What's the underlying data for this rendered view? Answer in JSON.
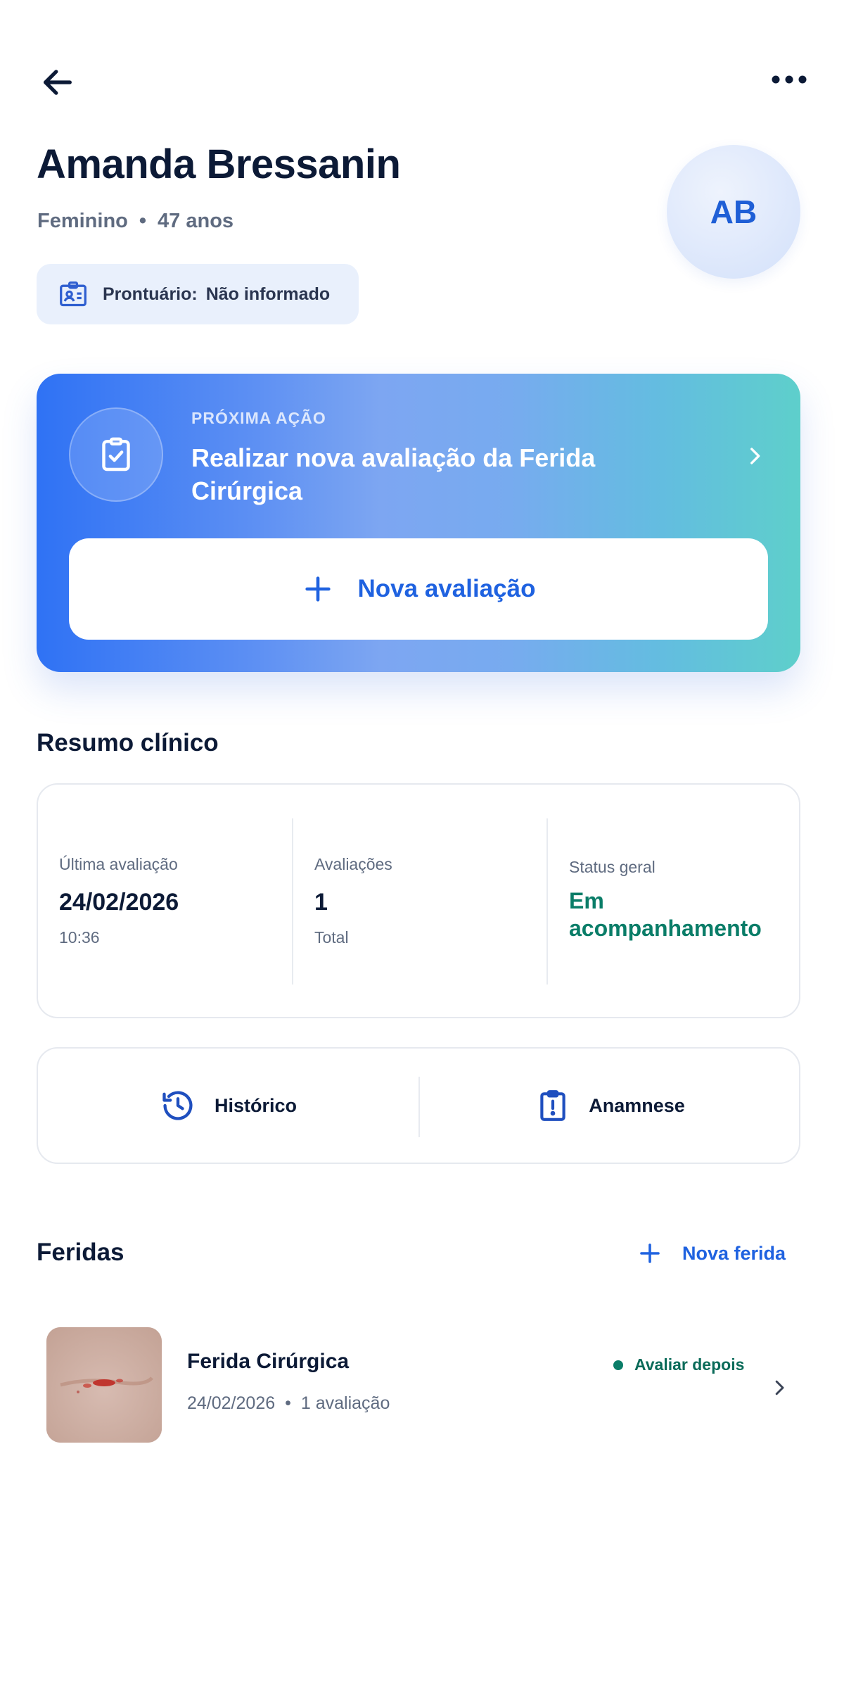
{
  "patient": {
    "name": "Amanda Bressanin",
    "gender": "Feminino",
    "age": "47 anos",
    "initials": "AB",
    "record_label": "Prontuário:",
    "record_value": "Não informado"
  },
  "next_action": {
    "kicker": "PRÓXIMA AÇÃO",
    "title": "Realizar nova avaliação da Ferida Cirúrgica",
    "button_label": "Nova avaliação"
  },
  "summary": {
    "title": "Resumo clínico",
    "last_eval_label": "Última avaliação",
    "last_eval_date": "24/02/2026",
    "last_eval_time": "10:36",
    "evals_label": "Avaliações",
    "evals_count": "1",
    "evals_sub": "Total",
    "status_label": "Status geral",
    "status_value": "Em acompanhamento"
  },
  "quick_actions": {
    "history_label": "Histórico",
    "anamnesis_label": "Anamnese"
  },
  "wounds": {
    "title": "Feridas",
    "new_label": "Nova ferida",
    "items": [
      {
        "name": "Ferida Cirúrgica",
        "date": "24/02/2026",
        "evals": "1 avaliação",
        "status": "Avaliar depois"
      }
    ]
  },
  "icons": {
    "back": "arrow-left-icon",
    "more": "more-horizontal-icon",
    "record": "id-card-icon",
    "action": "clipboard-check-icon",
    "chevron": "chevron-right-icon",
    "plus": "plus-icon",
    "history": "history-icon",
    "anamnesis": "clipboard-alert-icon"
  },
  "colors": {
    "primary": "#1f62e0",
    "dark_text": "#0c1a36",
    "muted_text": "#5f6b80",
    "status_green": "#0a7d68",
    "chip_bg": "#e9f0fc"
  }
}
